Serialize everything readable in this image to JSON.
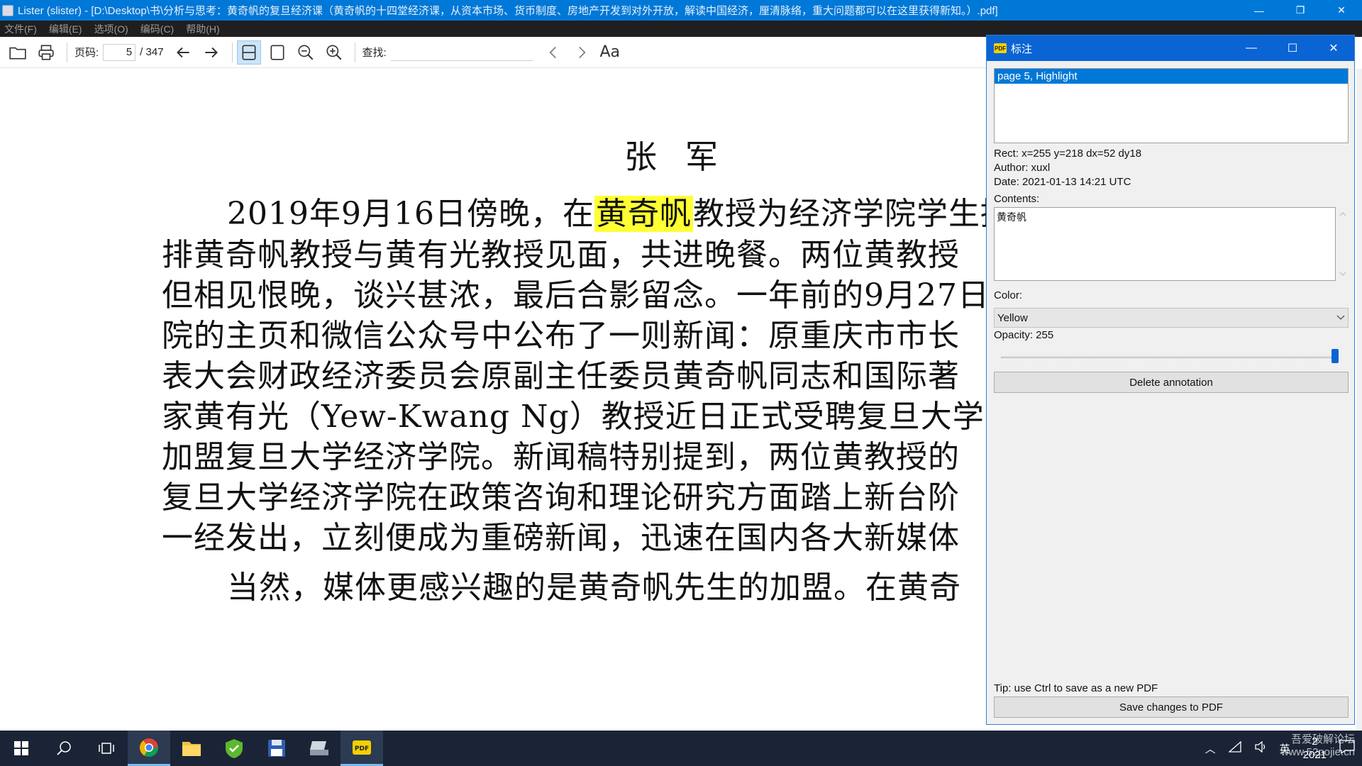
{
  "window": {
    "title": "Lister (slister) - [D:\\Desktop\\书\\分析与思考：黄奇帆的复旦经济课（黄奇帆的十四堂经济课，从资本市场、货币制度、房地产开发到对外开放，解读中国经济，厘清脉络，重大问题都可以在这里获得新知。）.pdf]",
    "minimize": "—",
    "restore": "❐",
    "close": "✕"
  },
  "menu": [
    "文件(F)",
    "编辑(E)",
    "选项(O)",
    "编码(C)",
    "帮助(H)"
  ],
  "toolbar": {
    "page_label": "页码:",
    "page_value": "5",
    "page_total": "/ 347",
    "find_label": "查找:",
    "find_value": "",
    "font_btn": "Aa"
  },
  "document": {
    "author": "张军",
    "lines": [
      {
        "pre": "2019年9月16日傍晚，在",
        "hl": "黄奇帆",
        "post": "教授为经济学院学生授"
      },
      {
        "pre": "排黄奇帆教授与黄有光教授见面，共进晚餐。两位黄教授",
        "hl": "",
        "post": ""
      },
      {
        "pre": "但相见恨晚，谈兴甚浓，最后合影留念。一年前的9月27日",
        "hl": "",
        "post": ""
      },
      {
        "pre": "院的主页和微信公众号中公布了一则新闻：原重庆市市长",
        "hl": "",
        "post": ""
      },
      {
        "pre": "表大会财政经济委员会原副主任委员黄奇帆同志和国际著",
        "hl": "",
        "post": ""
      },
      {
        "pre": "家黄有光（Yew-Kwang   Ng）教授近日正式受聘复旦大学",
        "hl": "",
        "post": ""
      },
      {
        "pre": "加盟复旦大学经济学院。新闻稿特别提到，两位黄教授的",
        "hl": "",
        "post": ""
      },
      {
        "pre": "复旦大学经济学院在政策咨询和理论研究方面踏上新台阶",
        "hl": "",
        "post": ""
      },
      {
        "pre": "一经发出，立刻便成为重磅新闻，迅速在国内各大新媒体",
        "hl": "",
        "post": ""
      },
      {
        "pre": "当然，媒体更感兴趣的是黄奇帆先生的加盟。在黄奇",
        "hl": "",
        "post": ""
      }
    ]
  },
  "dialog": {
    "title": "标注",
    "icon_text": "PDF",
    "annotations": [
      "page 5, Highlight"
    ],
    "rect": "Rect: x=255 y=218 dx=52 dy18",
    "author": "Author: xuxl",
    "date": "Date: 2021-01-13 14:21 UTC",
    "contents_label": "Contents:",
    "contents_value": "黄奇帆",
    "color_label": "Color:",
    "color_value": "Yellow",
    "opacity_label": "Opacity: 255",
    "opacity_fraction": 1.0,
    "delete_btn": "Delete annotation",
    "tip": "Tip: use Ctrl to save as a new PDF",
    "save_btn": "Save changes to PDF",
    "highlight_color": "#ffff33"
  },
  "taskbar": {
    "apps": [
      "windows-start",
      "search",
      "task-view",
      "chrome",
      "file-explorer",
      "checkmark-app",
      "save-app",
      "scanner-app",
      "pdf-app"
    ],
    "ime": "英",
    "clock_time": "2",
    "clock_date": "2021",
    "watermark": "吾爱破解论坛 www.52pojie.cn"
  }
}
